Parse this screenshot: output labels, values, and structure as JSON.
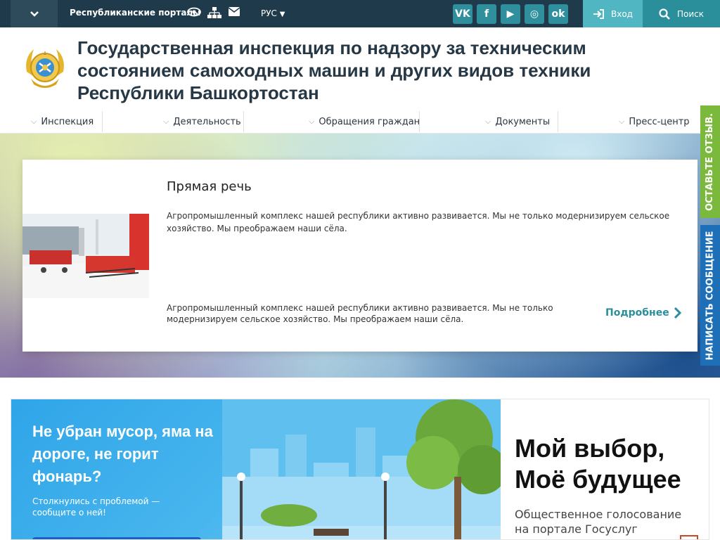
{
  "topbar": {
    "menu_icon": "chevron-down-icon",
    "portals_label": "Республиканские порталы",
    "icons": [
      "eye-icon",
      "sitemap-icon",
      "mail-icon"
    ],
    "lang": "РУС",
    "social": [
      {
        "name": "vk-icon",
        "glyph": "VK"
      },
      {
        "name": "facebook-icon",
        "glyph": "f"
      },
      {
        "name": "youtube-icon",
        "glyph": "▶"
      },
      {
        "name": "instagram-icon",
        "glyph": "◎"
      },
      {
        "name": "odnoklassniki-icon",
        "glyph": "ok"
      }
    ],
    "login_label": "Вход",
    "search_label": "Поиск"
  },
  "header": {
    "title": "Государственная инспекция по надзору за техническим состоянием самоходных машин и других видов техники Республики Башкортостан"
  },
  "nav": {
    "items": [
      {
        "label": "Инспекция"
      },
      {
        "label": "Деятельность"
      },
      {
        "label": "Обращения граждан"
      },
      {
        "label": "Документы"
      },
      {
        "label": "Пресс-центр"
      }
    ]
  },
  "hero": {
    "card_title": "Прямая речь",
    "card_lead": "Агропромышленный комплекс нашей республики активно развивается. Мы не только модернизируем сельское хозяйство. Мы преображаем наши сёла.",
    "card_text": "Агропромышленный комплекс нашей республики активно развивается. Мы не только модернизируем сельское хозяйство. Мы преображаем наши сёла.",
    "more_label": "Подробнее"
  },
  "side_tabs": {
    "feedback": "ОСТАВЬТЕ ОТЗЫВ.",
    "message": "НАПИСАТЬ СООБЩЕНИЕ"
  },
  "banner": {
    "headline": "Не убран мусор, яма на дороге, не горит фонарь?",
    "sub": "Столкнулись с проблемой — сообщите о ней!",
    "right_title": "Мой выбор, Моё будущее",
    "right_sub": "Общественное голосование на портале Госуслуг"
  },
  "colors": {
    "topbar": "#1f3a4a",
    "accent": "#2a8f9b",
    "feedback_tab": "#7ab93b",
    "message_tab": "#1d6fb8"
  }
}
